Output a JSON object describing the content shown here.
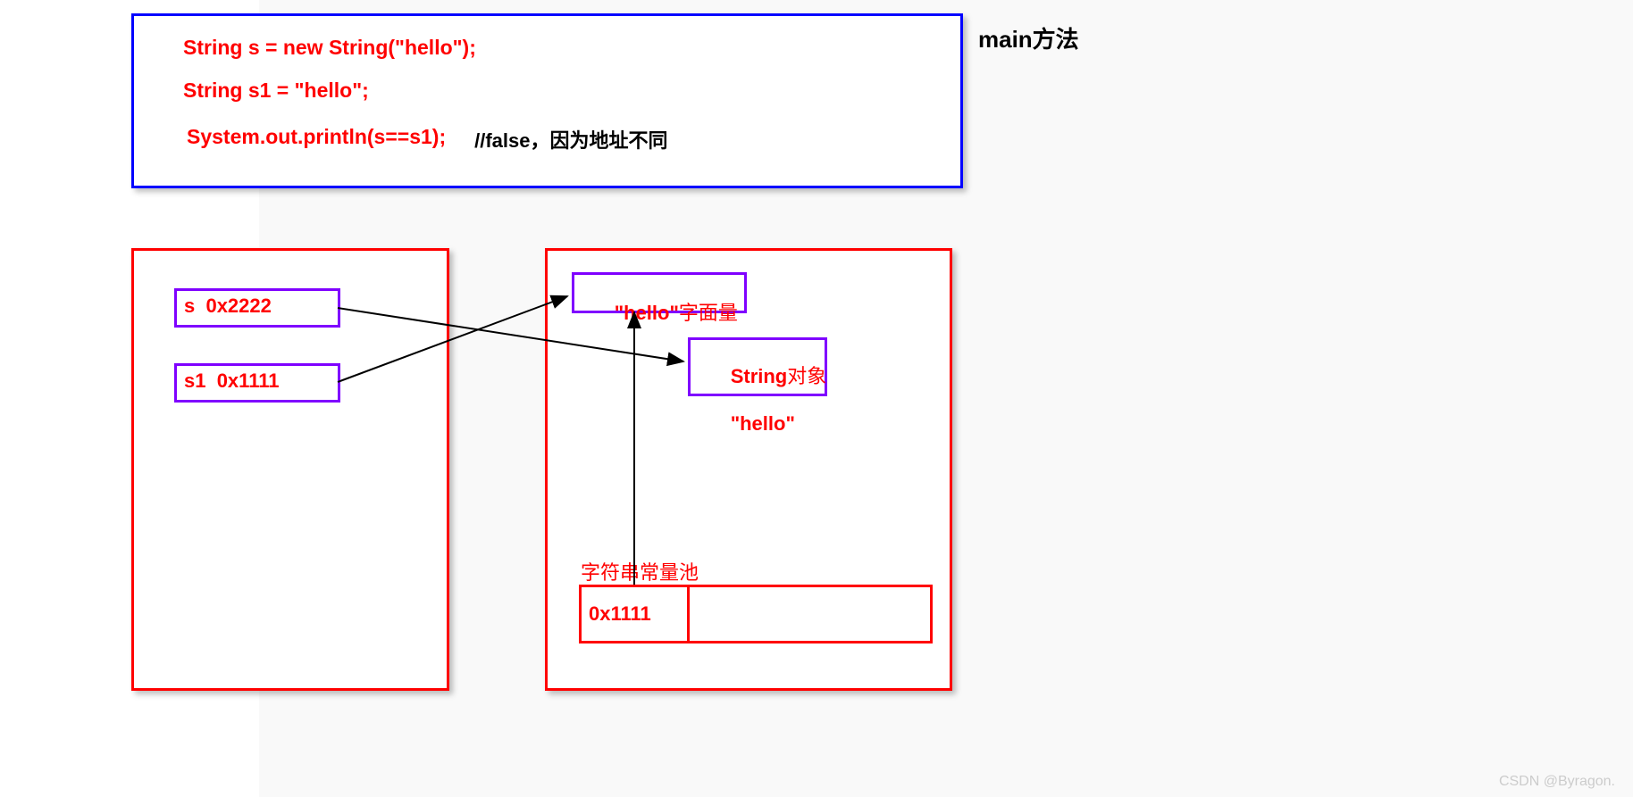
{
  "main_label": "main方法",
  "code": {
    "line1": "String s = new String(\"hello\");",
    "line2": "String s1 = \"hello\";",
    "line3_red": "System.out.println(s==s1);",
    "line3_comment": " //false，因为地址不同"
  },
  "stack": {
    "s_slot": "s  0x2222",
    "s1_slot": "s1  0x1111"
  },
  "heap": {
    "literal_box_strong": "\"hello\"",
    "literal_box_rest": "字面量",
    "object_box_line1_strong": "String",
    "object_box_line1_rest": "对象",
    "object_box_line2": "\"hello\""
  },
  "pool": {
    "label": "字符串常量池",
    "cell0": "0x1111"
  },
  "watermark": "CSDN @Byragon."
}
